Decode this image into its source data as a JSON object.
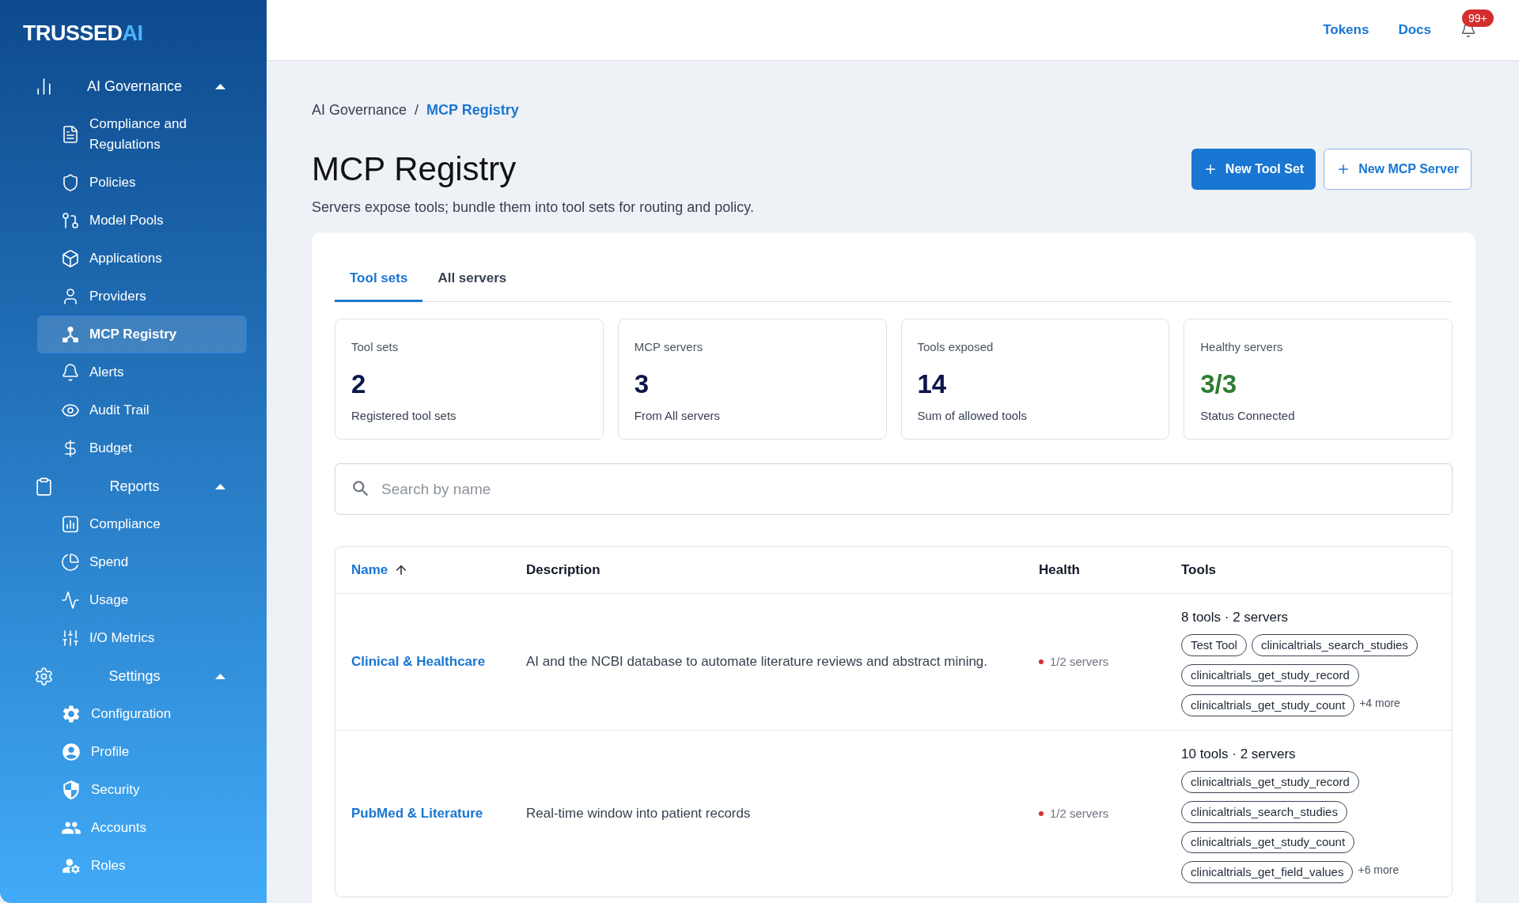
{
  "sidebar": {
    "logo": {
      "wordmark": "TRUSSED",
      "mark": "AI"
    },
    "groups": [
      {
        "label": "AI Governance",
        "expanded": true,
        "items": [
          {
            "label": "Compliance and Regulations",
            "selected": false
          },
          {
            "label": "Policies",
            "selected": false
          },
          {
            "label": "Model Pools",
            "selected": false
          },
          {
            "label": "Applications",
            "selected": false
          },
          {
            "label": "Providers",
            "selected": false
          },
          {
            "label": "MCP Registry",
            "selected": true
          },
          {
            "label": "Alerts",
            "selected": false
          },
          {
            "label": "Audit Trail",
            "selected": false
          },
          {
            "label": "Budget",
            "selected": false
          }
        ]
      },
      {
        "label": "Reports",
        "expanded": true,
        "items": [
          {
            "label": "Compliance",
            "selected": false
          },
          {
            "label": "Spend",
            "selected": false
          },
          {
            "label": "Usage",
            "selected": false
          },
          {
            "label": "I/O Metrics",
            "selected": false
          }
        ]
      },
      {
        "label": "Settings",
        "expanded": true,
        "items": [
          {
            "label": "Configuration",
            "selected": false
          },
          {
            "label": "Profile",
            "selected": false
          },
          {
            "label": "Security",
            "selected": false
          },
          {
            "label": "Accounts",
            "selected": false
          },
          {
            "label": "Roles",
            "selected": false
          }
        ]
      }
    ]
  },
  "top_bar": {
    "links": [
      "Tokens",
      "Docs"
    ],
    "notifications": {
      "badge": "99+"
    }
  },
  "breadcrumb": {
    "items": [
      {
        "label": "AI Governance",
        "current": false
      },
      {
        "label": "MCP Registry",
        "current": true
      }
    ],
    "separator": "/"
  },
  "page": {
    "title": "MCP Registry",
    "subtitle": "Servers expose tools; bundle them into tool sets for routing and policy."
  },
  "actions": [
    {
      "label": "New Tool Set",
      "kind": "primary"
    },
    {
      "label": "New MCP Server",
      "kind": "secondary"
    }
  ],
  "tabs": [
    {
      "label": "Tool sets",
      "selected": true
    },
    {
      "label": "All servers",
      "selected": false
    }
  ],
  "stats": [
    {
      "label": "Tool sets",
      "value": "2",
      "caption": "Registered tool sets",
      "color": "#0b1548"
    },
    {
      "label": "MCP servers",
      "value": "3",
      "caption": "From All servers",
      "color": "#0b1548"
    },
    {
      "label": "Tools exposed",
      "value": "14",
      "caption": "Sum of allowed tools",
      "color": "#0b1548"
    },
    {
      "label": "Healthy servers",
      "value": "3/3",
      "caption": "Status Connected",
      "color": "#2e7d32"
    }
  ],
  "search": {
    "placeholder": "Search by name"
  },
  "table": {
    "columns": [
      {
        "label": "Name",
        "sorted": true
      },
      {
        "label": "Description",
        "sorted": false
      },
      {
        "label": "Health",
        "sorted": false
      },
      {
        "label": "Tools",
        "sorted": false
      }
    ],
    "rows": [
      {
        "name": "Clinical & Healthcare",
        "description": "AI and the NCBI database to automate literature reviews and abstract mining.",
        "health": {
          "text": "1/2 servers",
          "color": "#d32f2f"
        },
        "tools": {
          "summary": "8 tools · 2 servers",
          "chips": [
            "Test Tool",
            "clinicaltrials_search_studies",
            "clinicaltrials_get_study_record",
            "clinicaltrials_get_study_count"
          ],
          "more": "+4 more"
        }
      },
      {
        "name": "PubMed & Literature",
        "description": "Real-time window into patient records",
        "health": {
          "text": "1/2 servers",
          "color": "#d32f2f"
        },
        "tools": {
          "summary": "10 tools · 2 servers",
          "chips": [
            "clinicaltrials_get_study_record",
            "clinicaltrials_search_studies",
            "clinicaltrials_get_study_count",
            "clinicaltrials_get_field_values"
          ],
          "more": "+6 more"
        }
      }
    ]
  }
}
